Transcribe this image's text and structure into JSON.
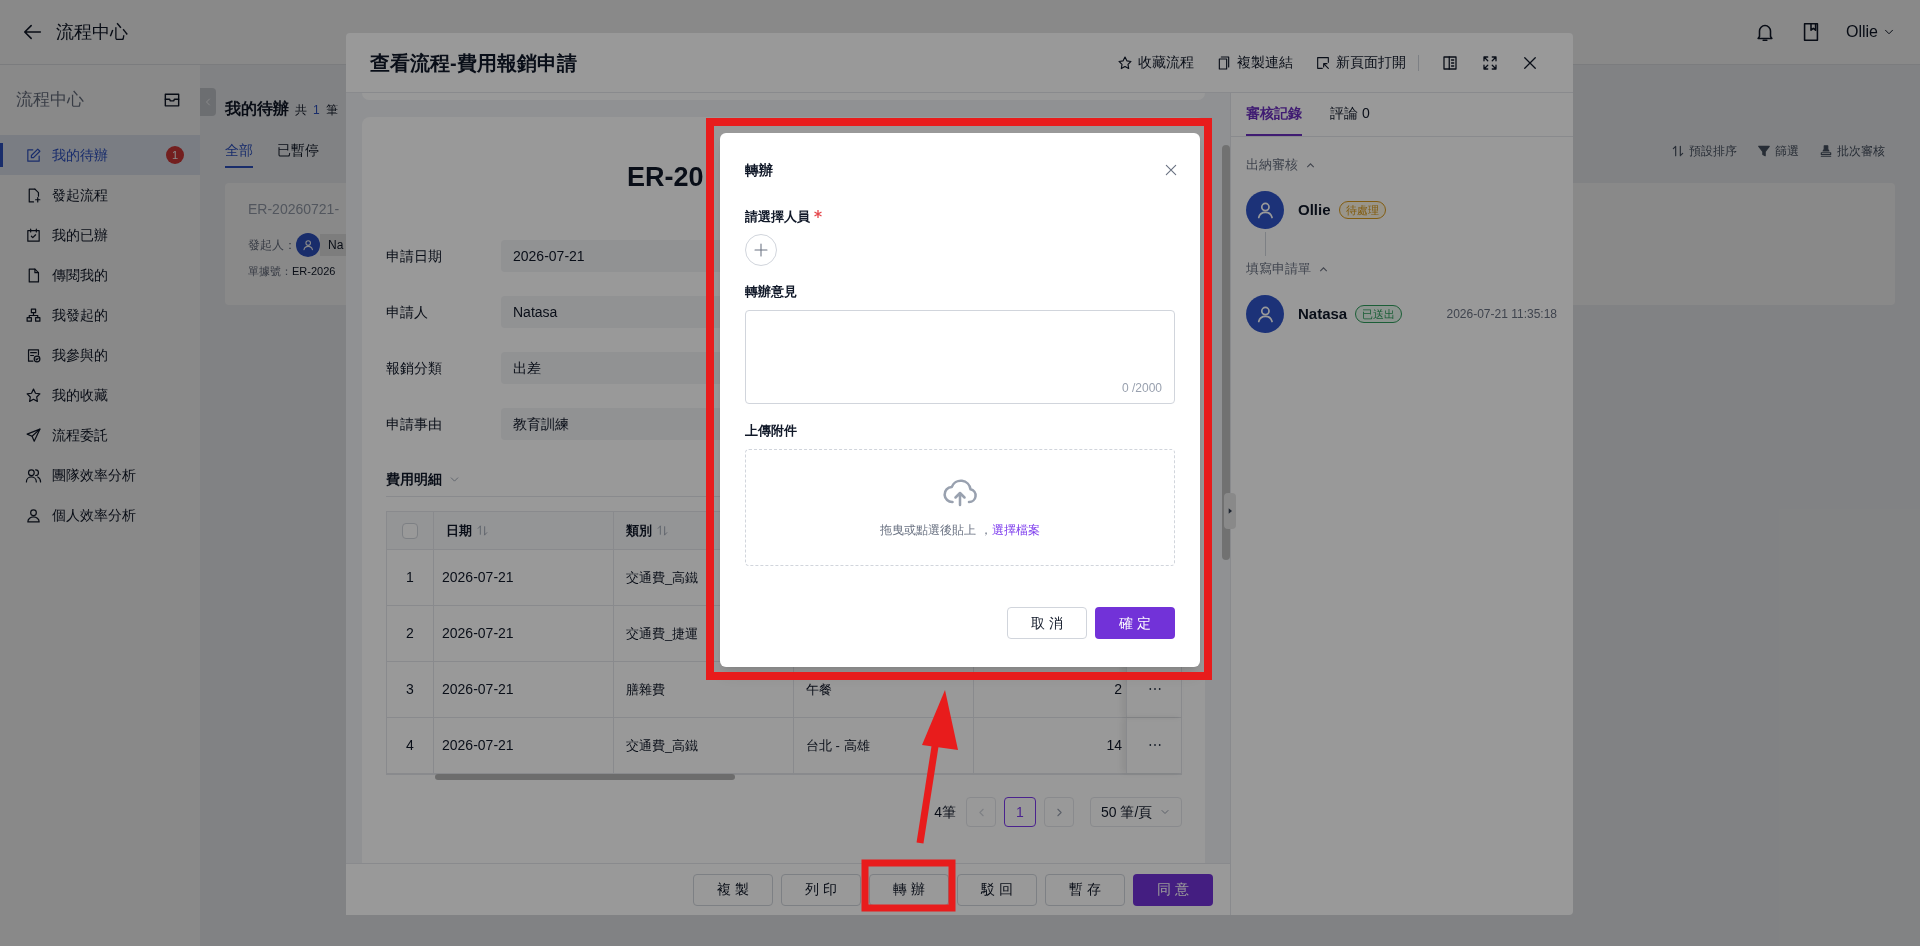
{
  "header": {
    "title": "流程中心",
    "user": "Ollie"
  },
  "sidebar": {
    "title": "流程中心",
    "items": [
      {
        "label": "我的待辦",
        "selected": true,
        "badge": "1"
      },
      {
        "label": "發起流程",
        "selected": false
      },
      {
        "label": "我的已辦",
        "selected": false
      },
      {
        "label": "傳閱我的",
        "selected": false
      },
      {
        "label": "我發起的",
        "selected": false
      },
      {
        "label": "我參與的",
        "selected": false
      },
      {
        "label": "我的收藏",
        "selected": false
      },
      {
        "label": "流程委託",
        "selected": false
      },
      {
        "label": "團隊效率分析",
        "selected": false
      },
      {
        "label": "個人效率分析",
        "selected": false
      }
    ]
  },
  "todo": {
    "title": "我的待辦",
    "count_label": "共",
    "count": "1",
    "count_unit": "筆",
    "tabs": [
      {
        "label": "全部",
        "selected": true
      },
      {
        "label": "已暫停",
        "selected": false
      }
    ],
    "toolbar": [
      "預設排序",
      "篩選",
      "批次審核"
    ],
    "card": {
      "number": "ER-20260721-",
      "initiator_label": "發起人：",
      "initiator": "Na",
      "doc_label": "單據號：",
      "doc_number": "ER-2026"
    }
  },
  "drawer": {
    "title": "查看流程-費用報銷申請",
    "actions": [
      "收藏流程",
      "複製連結",
      "新頁面打開"
    ],
    "form": {
      "heading": "ER-20",
      "fields": [
        {
          "label": "申請日期",
          "value": "2026-07-21"
        },
        {
          "label": "申請人",
          "value": "Natasa"
        },
        {
          "label": "報銷分類",
          "value": "出差"
        },
        {
          "label": "申請事由",
          "value": "教育訓練"
        }
      ],
      "section": "費用明細",
      "table": {
        "header_checkbox": {
          "checked": false
        },
        "columns": [
          "日期",
          "類別"
        ],
        "rows": [
          {
            "index": "1",
            "date": "2026-07-21",
            "category": "交通費_高鐵"
          },
          {
            "index": "2",
            "date": "2026-07-21",
            "category": "交通費_捷運"
          },
          {
            "index": "3",
            "date": "2026-07-21",
            "category": "膳雜費",
            "detail": "午餐",
            "amount": "2",
            "more": "⋯"
          },
          {
            "index": "4",
            "date": "2026-07-21",
            "category": "交通費_高鐵",
            "detail": "台北 - 高雄",
            "amount": "14",
            "more": "⋯"
          }
        ]
      },
      "pagination": {
        "total": "4筆",
        "page": "1",
        "page_size": "50 筆/頁"
      }
    },
    "buttons": [
      {
        "label": "複 製",
        "kind": "default"
      },
      {
        "label": "列 印",
        "kind": "default"
      },
      {
        "label": "轉 辦",
        "kind": "default"
      },
      {
        "label": "駁 回",
        "kind": "default"
      },
      {
        "label": "暫 存",
        "kind": "default"
      },
      {
        "label": "同 意",
        "kind": "primary"
      }
    ]
  },
  "review": {
    "tabs": [
      {
        "label": "審核記錄",
        "selected": true
      },
      {
        "label": "評論 0",
        "selected": false
      }
    ],
    "groups": [
      {
        "title": "出納審核",
        "expanded": true,
        "person": "Ollie",
        "status": "待處理",
        "kind": "pending"
      },
      {
        "title": "填寫申請單",
        "expanded": true,
        "person": "Natasa",
        "status": "已送出",
        "kind": "sent",
        "time": "2026-07-21 11:35:18"
      }
    ]
  },
  "dialog": {
    "title": "轉辦",
    "assignee_label": "請選擇人員",
    "required": true,
    "comment_label": "轉辦意見",
    "counter": "0 /2000",
    "upload_label": "上傳附件",
    "upload_hint": "拖曳或點選後貼上 ，",
    "upload_link": "選擇檔案",
    "buttons": [
      {
        "label": "取 消",
        "kind": "default"
      },
      {
        "label": "確 定",
        "kind": "primary"
      }
    ]
  }
}
